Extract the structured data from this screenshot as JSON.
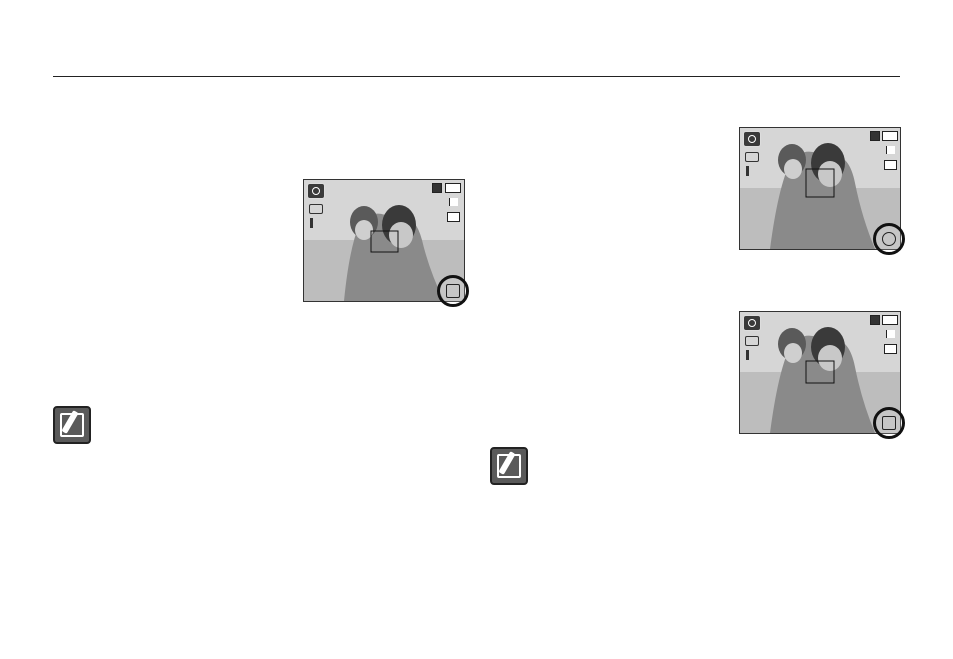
{
  "page": {
    "screens": [
      {
        "id": "screen-1",
        "mode_icon": "camera-icon",
        "badge_icon": "face-detection-icon"
      },
      {
        "id": "screen-2",
        "mode_icon": "camera-icon",
        "badge_icon": "smile-shot-icon"
      },
      {
        "id": "screen-3",
        "mode_icon": "camera-icon",
        "badge_icon": "blink-detection-icon"
      }
    ],
    "notes": [
      {
        "id": "note-1",
        "icon": "note-pencil-icon"
      },
      {
        "id": "note-2",
        "icon": "note-pencil-icon"
      }
    ],
    "colors": {
      "rule": "#222222",
      "screen_bg": "#d9d9d9",
      "icon_dark": "#3a3a3a"
    }
  }
}
